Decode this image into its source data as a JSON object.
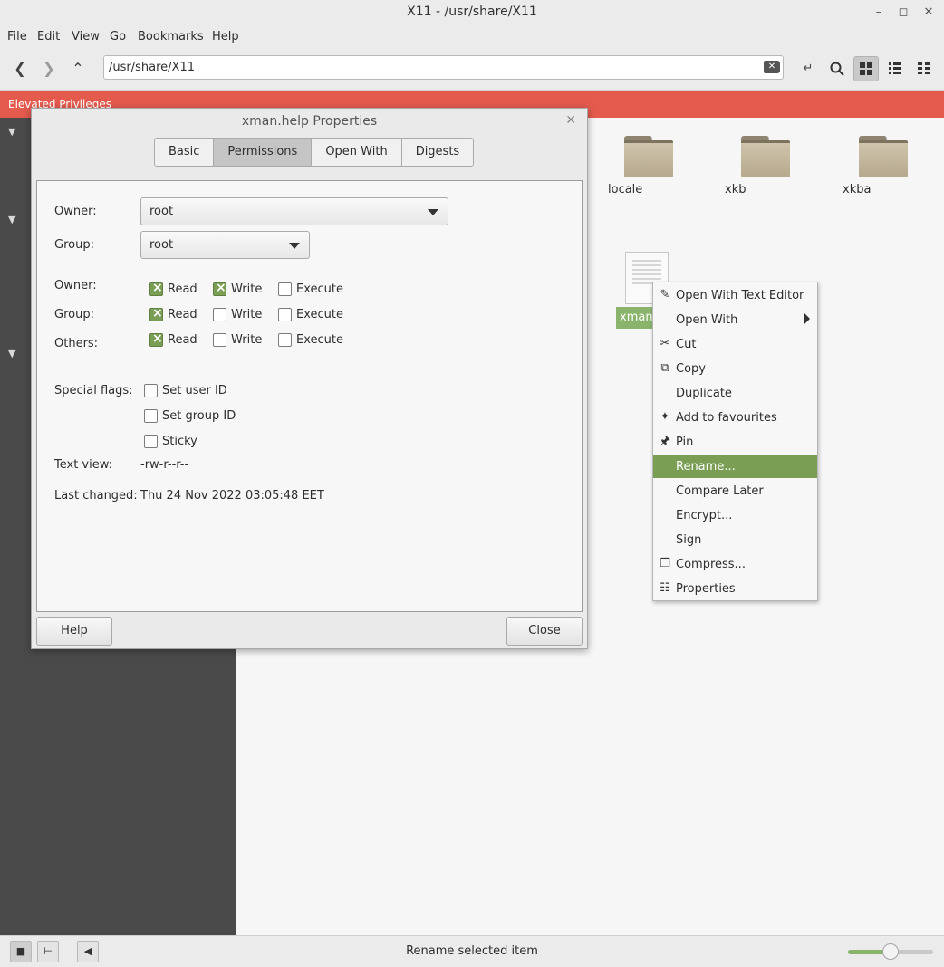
{
  "window": {
    "title": "X11 - /usr/share/X11"
  },
  "menubar": {
    "file": "File",
    "edit": "Edit",
    "view": "View",
    "go": "Go",
    "bookmarks": "Bookmarks",
    "help": "Help"
  },
  "toolbar": {
    "location": "/usr/share/X11"
  },
  "banner": {
    "text": "Elevated Privileges"
  },
  "files": {
    "folders": [
      {
        "label": "locale"
      },
      {
        "label": "xkb"
      },
      {
        "label": "xkba"
      }
    ],
    "selected_file": {
      "label": "xman.help"
    }
  },
  "context_menu": {
    "items": [
      {
        "label": "Open With Text Editor",
        "icon": "text-editor-icon"
      },
      {
        "label": "Open With",
        "icon": ""
      },
      {
        "label": "Cut",
        "icon": "scissors-icon"
      },
      {
        "label": "Copy",
        "icon": "copy-icon"
      },
      {
        "label": "Duplicate",
        "icon": ""
      },
      {
        "label": "Add to favourites",
        "icon": "star-icon"
      },
      {
        "label": "Pin",
        "icon": "pin-icon"
      },
      {
        "label": "Rename...",
        "icon": ""
      },
      {
        "label": "Compare Later",
        "icon": ""
      },
      {
        "label": "Encrypt...",
        "icon": ""
      },
      {
        "label": "Sign",
        "icon": ""
      },
      {
        "label": "Compress...",
        "icon": "compress-icon"
      },
      {
        "label": "Properties",
        "icon": "properties-icon"
      }
    ],
    "highlighted": "Rename..."
  },
  "dialog": {
    "title": "xman.help Properties",
    "tabs": [
      {
        "label": "Basic"
      },
      {
        "label": "Permissions"
      },
      {
        "label": "Open With"
      },
      {
        "label": "Digests"
      }
    ],
    "active_tab": "Permissions",
    "owner_label": "Owner:",
    "owner_value": "root",
    "group_label": "Group:",
    "group_value": "root",
    "perm_rows": [
      {
        "label": "Owner:",
        "read": true,
        "write": true,
        "execute": false
      },
      {
        "label": "Group:",
        "read": true,
        "write": false,
        "execute": false
      },
      {
        "label": "Others:",
        "read": true,
        "write": false,
        "execute": false
      }
    ],
    "perm_cols": {
      "read": "Read",
      "write": "Write",
      "execute": "Execute"
    },
    "special_flags_label": "Special flags:",
    "special_flags": [
      {
        "label": "Set user ID",
        "checked": false
      },
      {
        "label": "Set group ID",
        "checked": false
      },
      {
        "label": "Sticky",
        "checked": false
      }
    ],
    "text_view_label": "Text view:",
    "text_view_value": "-rw-r--r--",
    "last_changed_label": "Last changed:",
    "last_changed_value": "Thu 24 Nov 2022 03:05:48 EET",
    "help_button": "Help",
    "close_button": "Close"
  },
  "statusbar": {
    "text": "Rename selected item",
    "zoom_fraction": 0.5
  },
  "colors": {
    "accent": "#7a9f54",
    "banner": "#e45b4e",
    "sidebar": "#4a4a4a"
  }
}
